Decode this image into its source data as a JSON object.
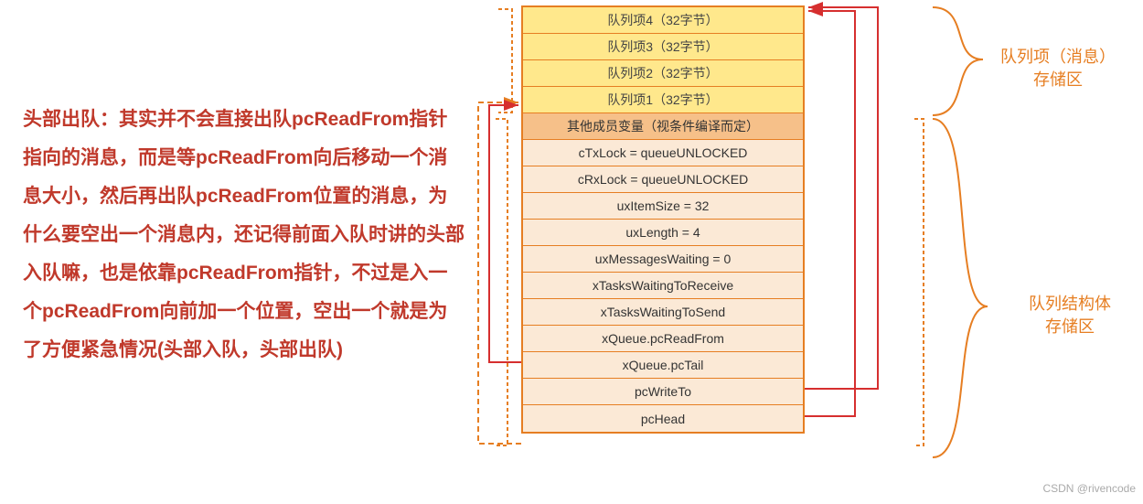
{
  "leftText": "头部出队：其实并不会直接出队pcReadFrom指针指向的消息，而是等pcReadFrom向后移动一个消息大小，然后再出队pcReadFrom位置的消息，为什么要空出一个消息内，还记得前面入队时讲的头部入队嘛，也是依靠pcReadFrom指针，不过是入一个pcReadFrom向前加一个位置，空出一个就是为了方便紧急情况(头部入队，头部出队)",
  "yellowRows": [
    "队列项4（32字节）",
    "队列项3（32字节）",
    "队列项2（32字节）",
    "队列项1（32字节）"
  ],
  "orangeHeader": "其他成员变量（视条件编译而定）",
  "lightRows": [
    "cTxLock = queueUNLOCKED",
    "cRxLock = queueUNLOCKED",
    "uxItemSize = 32",
    "uxLength = 4",
    "uxMessagesWaiting = 0",
    "xTasksWaitingToReceive",
    "xTasksWaitingToSend",
    "xQueue.pcReadFrom",
    "xQueue.pcTail",
    "pcWriteTo",
    "pcHead"
  ],
  "labelTop": "队列项（消息）\n存储区",
  "labelBottom": "队列结构体\n存储区",
  "watermark": "CSDN @rivencode"
}
